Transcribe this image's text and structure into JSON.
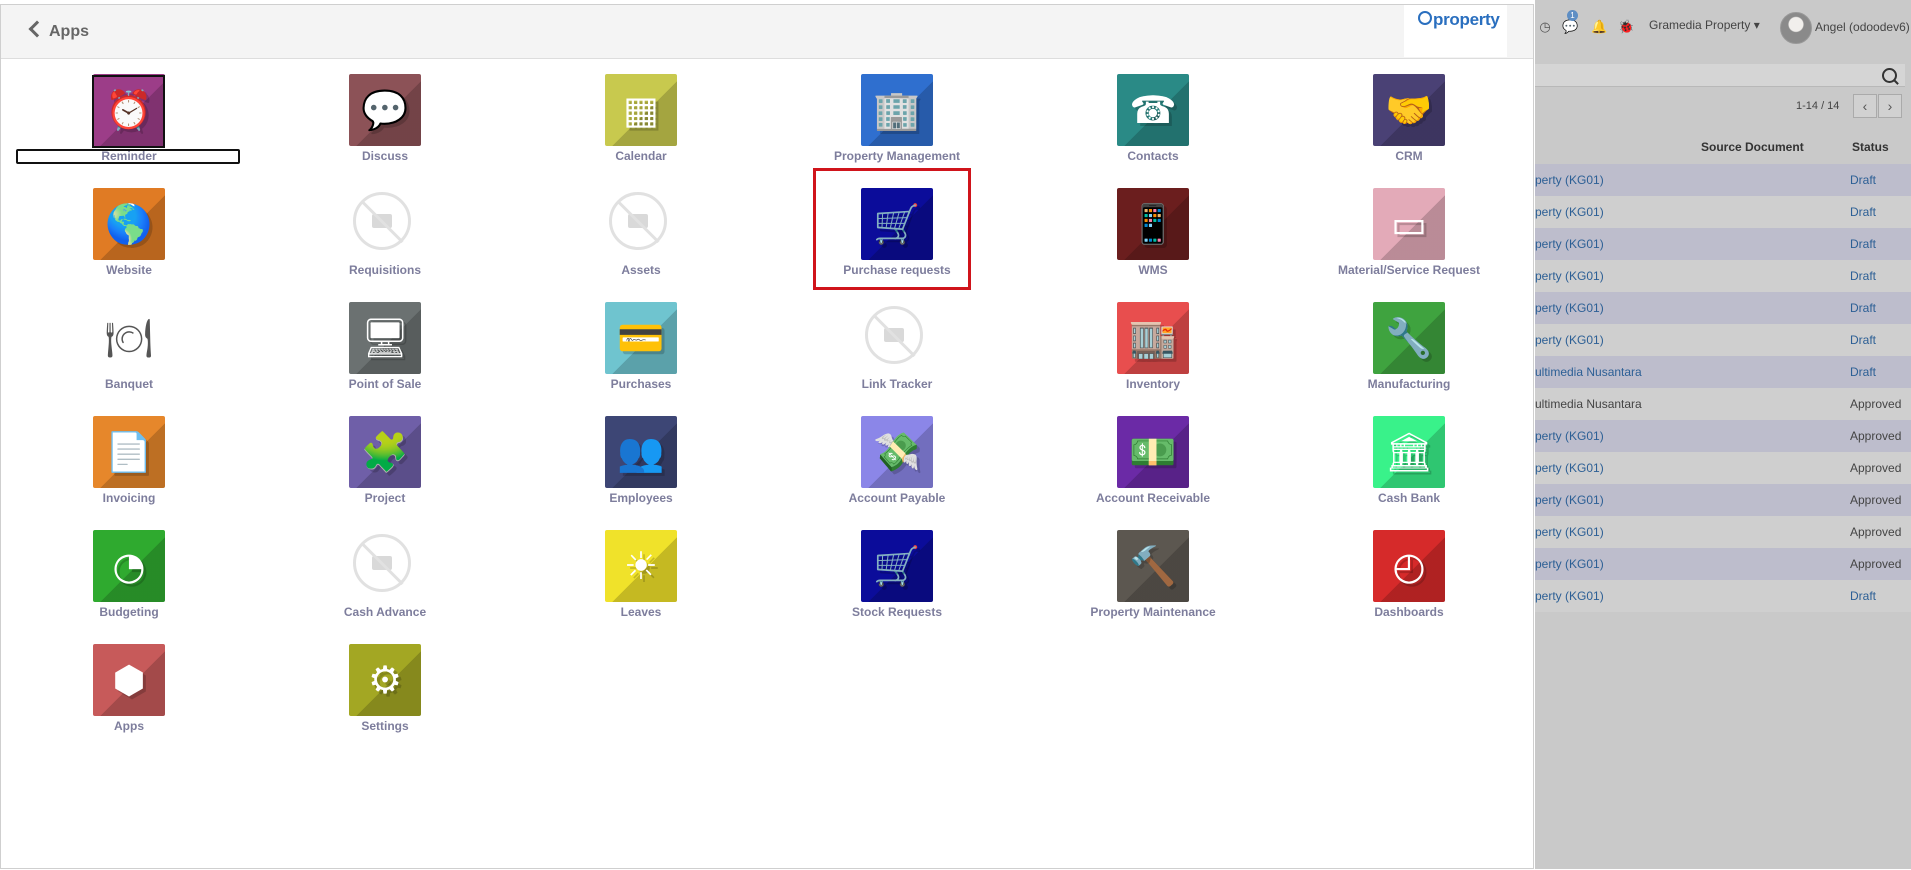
{
  "colors": {
    "label": "#7d7d9c",
    "highlight": "#d0141b",
    "link": "#2c5f95"
  },
  "header": {
    "back_label": "Apps",
    "logo_text": "property"
  },
  "apps": [
    {
      "label": "Reminder",
      "icon": "alarm-clock-icon",
      "bg": "#9c3d88",
      "glyph": "⏰"
    },
    {
      "label": "Discuss",
      "icon": "chat-bubble-icon",
      "bg": "#8c5257",
      "glyph": "💬"
    },
    {
      "label": "Calendar",
      "icon": "calendar-icon",
      "bg": "#c8c94e",
      "glyph": "▦"
    },
    {
      "label": "Property Management",
      "icon": "building-hands-icon",
      "bg": "#2f6fcf",
      "glyph": "🏢"
    },
    {
      "label": "Contacts",
      "icon": "contact-phone-icon",
      "bg": "#2a8a86",
      "glyph": "☎"
    },
    {
      "label": "CRM",
      "icon": "handshake-icon",
      "bg": "#4a4175",
      "glyph": "🤝"
    },
    {
      "label": "Website",
      "icon": "globe-icon",
      "bg": "#e07b24",
      "glyph": "🌎"
    },
    {
      "label": "Requisitions",
      "icon": "no-image-icon",
      "bg": "",
      "glyph": ""
    },
    {
      "label": "Assets",
      "icon": "no-image-icon",
      "bg": "",
      "glyph": ""
    },
    {
      "label": "Purchase requests",
      "icon": "shopping-cart-icon",
      "bg": "#0b0c9a",
      "glyph": "🛒"
    },
    {
      "label": "WMS",
      "icon": "mobile-barcode-icon",
      "bg": "#6b1e1e",
      "glyph": "📱"
    },
    {
      "label": "Material/Service Request",
      "icon": "ticket-card-icon",
      "bg": "#e3aab8",
      "glyph": "▭"
    },
    {
      "label": "Banquet",
      "icon": "banquet-cloche-icon",
      "bg": "",
      "glyph": "🍽"
    },
    {
      "label": "Point of Sale",
      "icon": "monitor-icon",
      "bg": "#6b7171",
      "glyph": "🖥"
    },
    {
      "label": "Purchases",
      "icon": "credit-card-icon",
      "bg": "#6fc4cf",
      "glyph": "💳"
    },
    {
      "label": "Link Tracker",
      "icon": "no-image-icon",
      "bg": "",
      "glyph": ""
    },
    {
      "label": "Inventory",
      "icon": "warehouse-icon",
      "bg": "#e84e4e",
      "glyph": "🏬"
    },
    {
      "label": "Manufacturing",
      "icon": "wrench-icon",
      "bg": "#3fa33f",
      "glyph": "🔧"
    },
    {
      "label": "Invoicing",
      "icon": "document-icon",
      "bg": "#e6872b",
      "glyph": "📄"
    },
    {
      "label": "Project",
      "icon": "puzzle-icon",
      "bg": "#6f5fa8",
      "glyph": "🧩"
    },
    {
      "label": "Employees",
      "icon": "users-group-icon",
      "bg": "#3d4675",
      "glyph": "👥"
    },
    {
      "label": "Account Payable",
      "icon": "hand-money-icon",
      "bg": "#8b86e8",
      "glyph": "💸"
    },
    {
      "label": "Account Receivable",
      "icon": "money-stack-icon",
      "bg": "#6b2aa6",
      "glyph": "💵"
    },
    {
      "label": "Cash Bank",
      "icon": "bank-icon",
      "bg": "#39f28a",
      "glyph": "🏛"
    },
    {
      "label": "Budgeting",
      "icon": "pie-chart-icon",
      "bg": "#2faa2f",
      "glyph": "◔"
    },
    {
      "label": "Cash Advance",
      "icon": "no-image-icon",
      "bg": "",
      "glyph": ""
    },
    {
      "label": "Leaves",
      "icon": "sun-icon",
      "bg": "#f0e22a",
      "glyph": "☀"
    },
    {
      "label": "Stock Requests",
      "icon": "shopping-cart-icon",
      "bg": "#0b0c9a",
      "glyph": "🛒"
    },
    {
      "label": "Property Maintenance",
      "icon": "hammer-icon",
      "bg": "#5c5750",
      "glyph": "🔨"
    },
    {
      "label": "Dashboards",
      "icon": "speedometer-icon",
      "bg": "#d62a2a",
      "glyph": "◴"
    },
    {
      "label": "Apps",
      "icon": "cubes-icon",
      "bg": "#c75a5a",
      "glyph": "⬢"
    },
    {
      "label": "Settings",
      "icon": "gear-icon",
      "bg": "#a3a723",
      "glyph": "⚙"
    }
  ],
  "background_view": {
    "company": "Gramedia Property",
    "user": "Angel (odoodev6)",
    "notification_count": "1",
    "pager": "1-14 / 14",
    "columns": {
      "source": "Source Document",
      "status": "Status"
    },
    "rows": [
      {
        "source": "perty (KG01)",
        "status": "Draft"
      },
      {
        "source": "perty (KG01)",
        "status": "Draft"
      },
      {
        "source": "perty (KG01)",
        "status": "Draft"
      },
      {
        "source": "perty (KG01)",
        "status": "Draft"
      },
      {
        "source": "perty (KG01)",
        "status": "Draft"
      },
      {
        "source": "perty (KG01)",
        "status": "Draft"
      },
      {
        "source": "ultimedia Nusantara",
        "status": "Draft"
      },
      {
        "source": "ultimedia Nusantara",
        "status": "Approved"
      },
      {
        "source": "perty (KG01)",
        "status": "Approved"
      },
      {
        "source": "perty (KG01)",
        "status": "Approved"
      },
      {
        "source": "perty (KG01)",
        "status": "Approved"
      },
      {
        "source": "perty (KG01)",
        "status": "Approved"
      },
      {
        "source": "perty (KG01)",
        "status": "Approved"
      },
      {
        "source": "perty (KG01)",
        "status": "Draft"
      }
    ]
  }
}
